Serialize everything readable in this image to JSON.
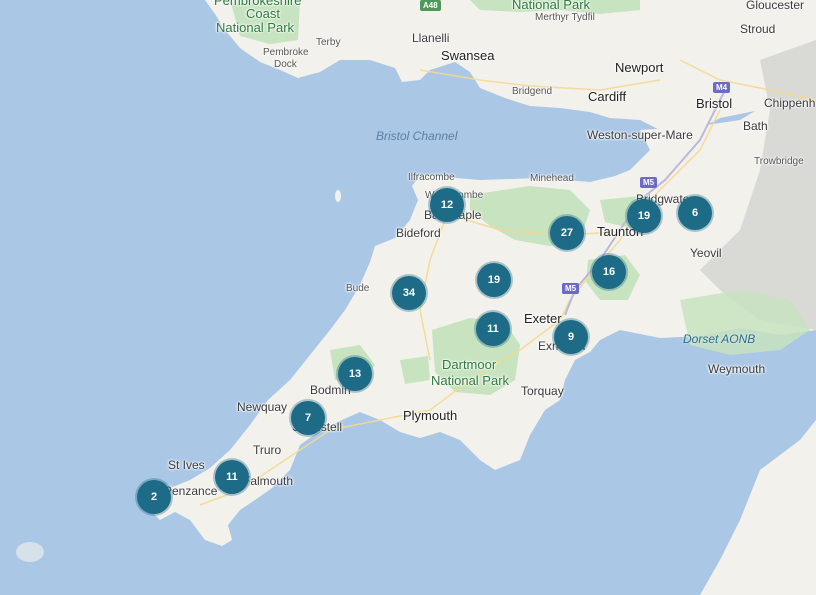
{
  "map": {
    "places": [
      {
        "id": "pembrokeshire",
        "text": "Pembrokeshire",
        "cls": "park"
      },
      {
        "id": "coast",
        "text": "Coast",
        "cls": "park"
      },
      {
        "id": "national-park-wales",
        "text": "National Park",
        "cls": "park"
      },
      {
        "id": "terby",
        "text": "Terby",
        "cls": "sm"
      },
      {
        "id": "pembroke",
        "text": "Pembroke",
        "cls": "sm"
      },
      {
        "id": "dock",
        "text": "Dock",
        "cls": "sm"
      },
      {
        "id": "llanelli",
        "text": "Llanelli",
        "cls": ""
      },
      {
        "id": "swansea",
        "text": "Swansea",
        "cls": "big"
      },
      {
        "id": "national-park-top",
        "text": "National Park",
        "cls": "park"
      },
      {
        "id": "merthyr",
        "text": "Merthyr Tydfil",
        "cls": "sm"
      },
      {
        "id": "bridgend",
        "text": "Bridgend",
        "cls": "sm"
      },
      {
        "id": "newport",
        "text": "Newport",
        "cls": "big"
      },
      {
        "id": "cardiff",
        "text": "Cardiff",
        "cls": "big"
      },
      {
        "id": "gloucester",
        "text": "Gloucester",
        "cls": ""
      },
      {
        "id": "stroud",
        "text": "Stroud",
        "cls": ""
      },
      {
        "id": "bristol",
        "text": "Bristol",
        "cls": "big"
      },
      {
        "id": "chippenham",
        "text": "Chippenh",
        "cls": ""
      },
      {
        "id": "bath",
        "text": "Bath",
        "cls": ""
      },
      {
        "id": "weston",
        "text": "Weston-super-Mare",
        "cls": ""
      },
      {
        "id": "trowbridge",
        "text": "Trowbridge",
        "cls": "sm"
      },
      {
        "id": "bristol-channel",
        "text": "Bristol Channel",
        "cls": "water"
      },
      {
        "id": "ilfracombe",
        "text": "Ilfracombe",
        "cls": "sm"
      },
      {
        "id": "minehead",
        "text": "Minehead",
        "cls": "sm"
      },
      {
        "id": "woolacombe",
        "text": "Woolacombe",
        "cls": "sm"
      },
      {
        "id": "barnstaple",
        "text": "Barnstaple",
        "cls": ""
      },
      {
        "id": "bridgwater",
        "text": "Bridgwater",
        "cls": ""
      },
      {
        "id": "bideford",
        "text": "Bideford",
        "cls": ""
      },
      {
        "id": "taunton",
        "text": "Taunton",
        "cls": "big"
      },
      {
        "id": "yeovil",
        "text": "Yeovil",
        "cls": ""
      },
      {
        "id": "bude",
        "text": "Bude",
        "cls": "sm"
      },
      {
        "id": "exeter",
        "text": "Exeter",
        "cls": "big"
      },
      {
        "id": "exmouth",
        "text": "Exmouth",
        "cls": ""
      },
      {
        "id": "dorset-aonb",
        "text": "Dorset AONB",
        "cls": "aonb"
      },
      {
        "id": "dartmoor-1",
        "text": "Dartmoor",
        "cls": "park"
      },
      {
        "id": "dartmoor-2",
        "text": "National Park",
        "cls": "park"
      },
      {
        "id": "weymouth",
        "text": "Weymouth",
        "cls": ""
      },
      {
        "id": "bodmin",
        "text": "Bodmin",
        "cls": ""
      },
      {
        "id": "torquay",
        "text": "Torquay",
        "cls": ""
      },
      {
        "id": "newquay",
        "text": "Newquay",
        "cls": ""
      },
      {
        "id": "plymouth",
        "text": "Plymouth",
        "cls": "big"
      },
      {
        "id": "st-austell",
        "text": "St Austell",
        "cls": ""
      },
      {
        "id": "truro",
        "text": "Truro",
        "cls": ""
      },
      {
        "id": "st-ives",
        "text": "St Ives",
        "cls": ""
      },
      {
        "id": "falmouth",
        "text": "Falmouth",
        "cls": ""
      },
      {
        "id": "penzance",
        "text": "Penzance",
        "cls": ""
      }
    ],
    "road_shields": [
      {
        "id": "a48",
        "text": "A48",
        "cls": "a"
      },
      {
        "id": "m4",
        "text": "M4",
        "cls": "m"
      },
      {
        "id": "m5-north",
        "text": "M5",
        "cls": "m"
      },
      {
        "id": "m5-south",
        "text": "M5",
        "cls": "m"
      }
    ],
    "clusters": [
      {
        "id": "barnstaple",
        "count": "12"
      },
      {
        "id": "exmoor",
        "count": "27"
      },
      {
        "id": "bridgwater",
        "count": "19"
      },
      {
        "id": "yeovil",
        "count": "6"
      },
      {
        "id": "blackdown",
        "count": "16"
      },
      {
        "id": "mid-devon",
        "count": "19"
      },
      {
        "id": "holsworthy",
        "count": "34"
      },
      {
        "id": "okehampton",
        "count": "11"
      },
      {
        "id": "exmouth",
        "count": "9"
      },
      {
        "id": "bodmin",
        "count": "13"
      },
      {
        "id": "st-austell",
        "count": "7"
      },
      {
        "id": "falmouth",
        "count": "11"
      },
      {
        "id": "penzance",
        "count": "2"
      }
    ],
    "colors": {
      "sea": "#aac7e6",
      "land": "#f3f1ec",
      "park": "#c7e3bf",
      "cluster": "#1d6b86"
    }
  }
}
